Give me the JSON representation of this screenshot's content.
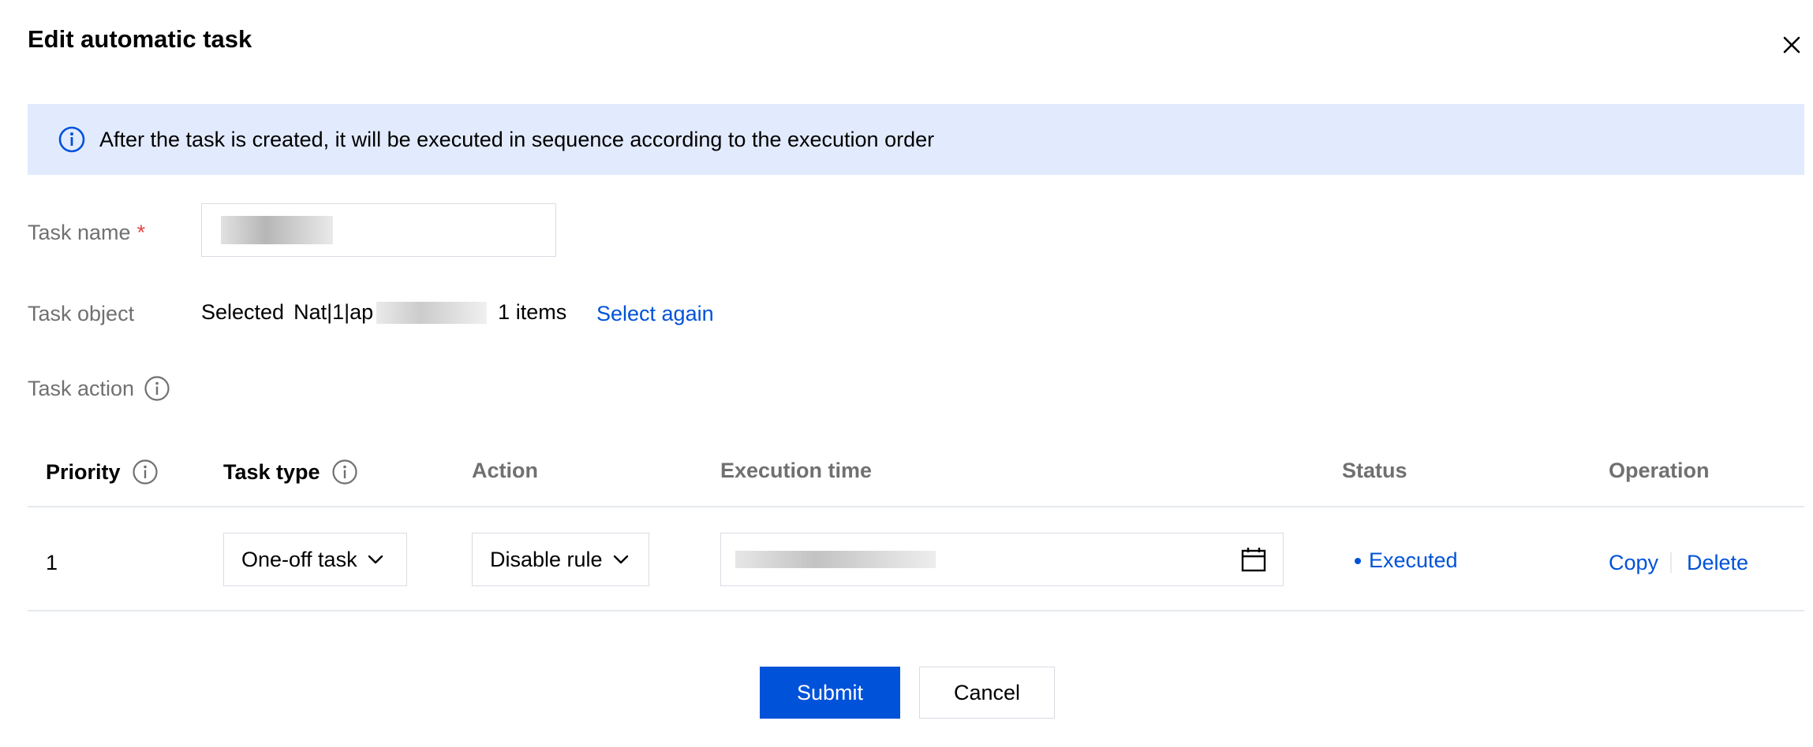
{
  "dialog": {
    "title": "Edit automatic task"
  },
  "banner": {
    "text": "After the task is created, it will be executed in sequence according to the execution order"
  },
  "form": {
    "task_name_label": "Task name",
    "required_mark": "*",
    "task_object_label": "Task object",
    "task_object_prefix": "Selected",
    "task_object_name": "Nat|1|ap",
    "task_object_count": "1 items",
    "select_again": "Select again",
    "task_action_label": "Task action"
  },
  "table": {
    "headers": {
      "priority": "Priority",
      "task_type": "Task type",
      "action": "Action",
      "execution_time": "Execution time",
      "status": "Status",
      "operation": "Operation"
    },
    "rows": [
      {
        "priority": "1",
        "task_type": "One-off task",
        "action": "Disable rule",
        "status": "Executed",
        "copy": "Copy",
        "delete": "Delete"
      }
    ]
  },
  "footer": {
    "submit": "Submit",
    "cancel": "Cancel"
  },
  "colors": {
    "primary": "#0052d9",
    "banner_bg": "#e2ebfd",
    "required": "#e54545"
  },
  "icons": {
    "close": "close-icon",
    "info": "info-icon",
    "chevron": "chevron-down-icon",
    "calendar": "calendar-icon"
  }
}
